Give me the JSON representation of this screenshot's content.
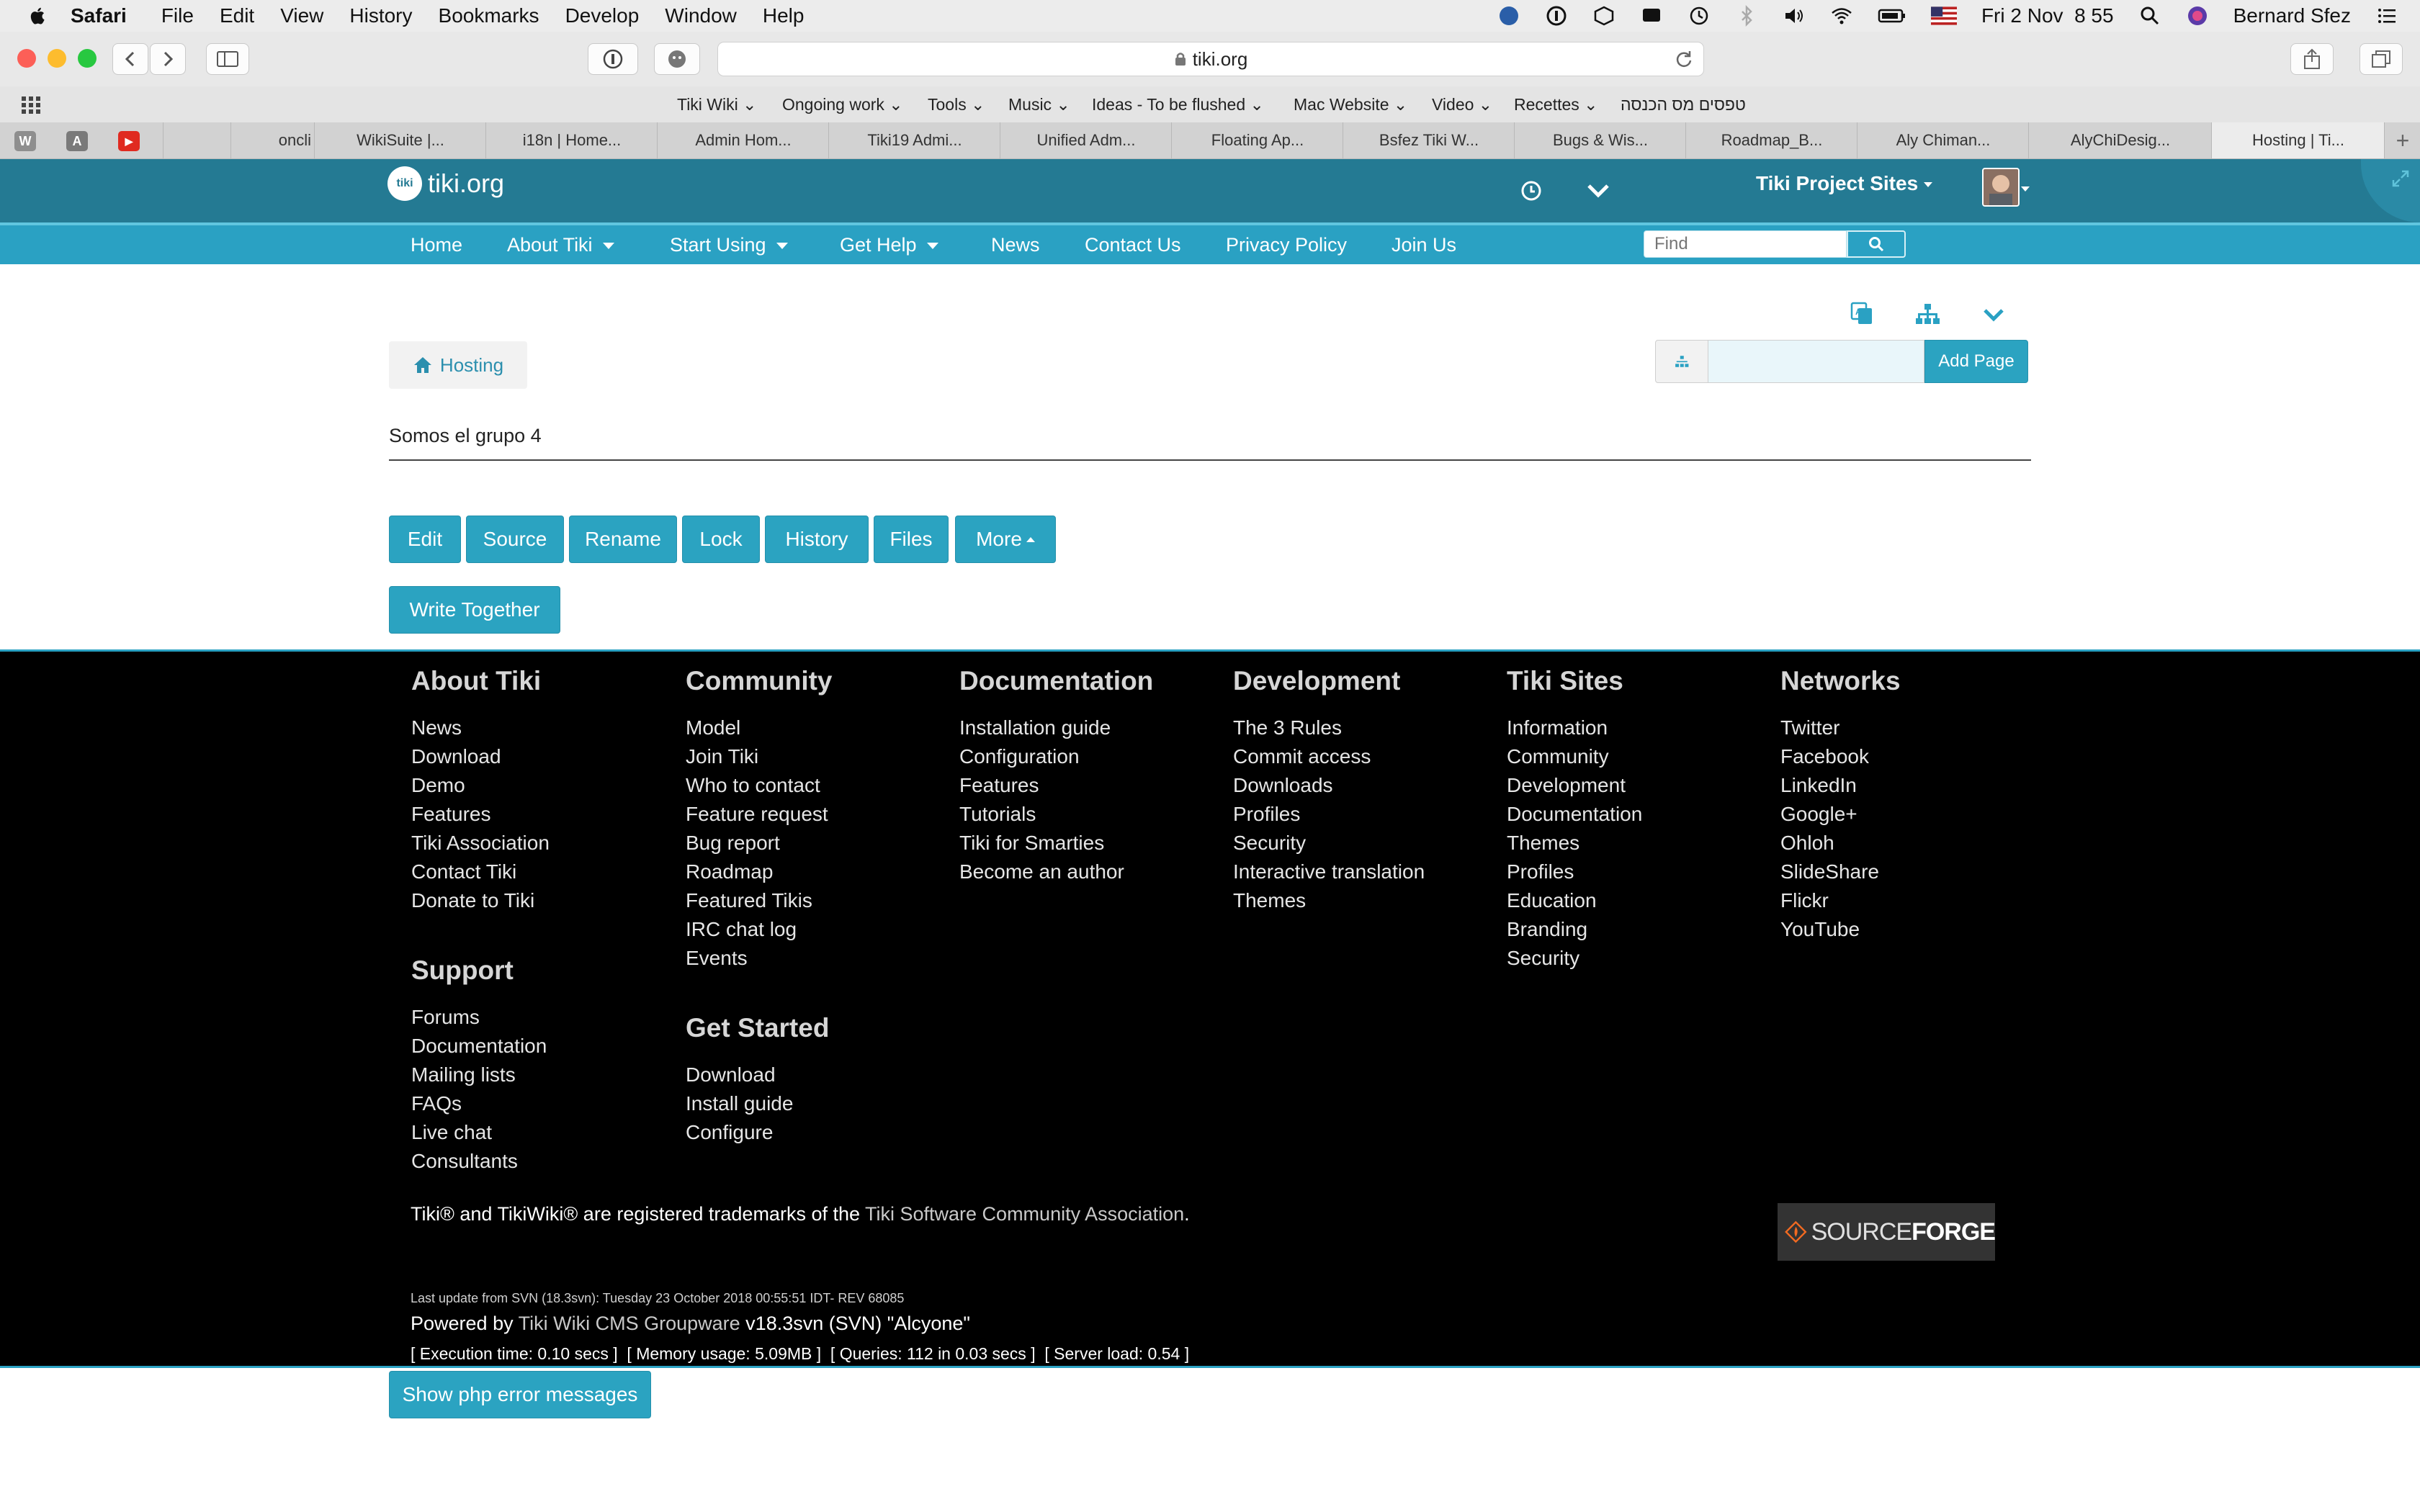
{
  "menubar": {
    "app": "Safari",
    "items": [
      "File",
      "Edit",
      "View",
      "History",
      "Bookmarks",
      "Develop",
      "Window",
      "Help"
    ],
    "datetime": "Fri 2 Nov  8 55",
    "user": "Bernard Sfez"
  },
  "browser": {
    "url": "tiki.org",
    "bookmarks": [
      "Tiki Wiki",
      "Ongoing work",
      "Tools",
      "Music",
      "Ideas - To be flushed",
      "Mac Website",
      "Video",
      "Recettes",
      "טפסים מס הכנסה"
    ],
    "pinned_tabs": [
      "W",
      "A",
      "▶"
    ],
    "tabs": [
      "oncli",
      "WikiSuite |...",
      "i18n | Home...",
      "Admin Hom...",
      "Tiki19 Admi...",
      "Unified Adm...",
      "Floating Ap...",
      "Bsfez Tiki W...",
      "Bugs & Wis...",
      "Roadmap_B...",
      "Aly Chiman...",
      "AlyChiDesig...",
      "Hosting | Ti..."
    ],
    "new_tab": "+"
  },
  "site": {
    "logo_text": "tiki.org",
    "logo_mark": "tiki",
    "project_sites": "Tiki Project Sites",
    "nav": [
      {
        "label": "Home",
        "dropdown": false
      },
      {
        "label": "About Tiki",
        "dropdown": true
      },
      {
        "label": "Start Using",
        "dropdown": true
      },
      {
        "label": "Get Help",
        "dropdown": true
      },
      {
        "label": "News",
        "dropdown": false
      },
      {
        "label": "Contact Us",
        "dropdown": false
      },
      {
        "label": "Privacy Policy",
        "dropdown": false
      },
      {
        "label": "Join Us",
        "dropdown": false
      }
    ],
    "search_placeholder": "Find"
  },
  "page": {
    "breadcrumb": "Hosting",
    "content_text": "Somos el grupo 4",
    "add_page_label": "Add Page",
    "actions": [
      "Edit",
      "Source",
      "Rename",
      "Lock",
      "History",
      "Files",
      "More"
    ],
    "write_together": "Write Together",
    "show_php_errors": "Show php error messages"
  },
  "footer": {
    "columns": [
      {
        "title": "About Tiki",
        "links": [
          "News",
          "Download",
          "Demo",
          "Features",
          "Tiki Association",
          "Contact Tiki",
          "Donate to Tiki"
        ]
      },
      {
        "title": "Community",
        "links": [
          "Model",
          "Join Tiki",
          "Who to contact",
          "Feature request",
          "Bug report",
          "Roadmap",
          "Featured Tikis",
          "IRC chat log",
          "Events"
        ]
      },
      {
        "title": "Documentation",
        "links": [
          "Installation guide",
          "Configuration",
          "Features",
          "Tutorials",
          "Tiki for Smarties",
          "Become an author"
        ]
      },
      {
        "title": "Development",
        "links": [
          "The 3 Rules",
          "Commit access",
          "Downloads",
          "Profiles",
          "Security",
          "Interactive translation",
          "Themes"
        ]
      },
      {
        "title": "Tiki Sites",
        "links": [
          "Information",
          "Community",
          "Development",
          "Documentation",
          "Themes",
          "Profiles",
          "Education",
          "Branding",
          "Security"
        ]
      },
      {
        "title": "Networks",
        "links": [
          "Twitter",
          "Facebook",
          "LinkedIn",
          "Google+",
          "Ohloh",
          "SlideShare",
          "Flickr",
          "YouTube"
        ]
      },
      {
        "title": "Support",
        "links": [
          "Forums",
          "Documentation",
          "Mailing lists",
          "FAQs",
          "Live chat",
          "Consultants"
        ]
      },
      {
        "title": "Get Started",
        "links": [
          "Download",
          "Install guide",
          "Configure"
        ]
      }
    ],
    "trademark_prefix": "Tiki® and TikiWiki® are registered trademarks of the",
    "trademark_link": "Tiki Software Community Association",
    "trademark_suffix": ".",
    "sourceforge": {
      "source": "SOURCE",
      "forge": "FORGE"
    },
    "last_update": "Last update from SVN (18.3svn): Tuesday 23 October 2018 00:55:51 IDT- REV 68085",
    "powered_prefix": "Powered by",
    "powered_link": "Tiki Wiki CMS Groupware",
    "powered_suffix": "v18.3svn (SVN) \"Alcyone\"",
    "stats": "[ Execution time: 0.10 secs ]  [ Memory usage: 5.09MB ]  [ Queries: 112 in 0.03 secs ]  [ Server load: 0.54 ]"
  },
  "colors": {
    "header": "#247a93",
    "nav": "#2aa1c3",
    "button": "#2ba3c1",
    "footer": "#000000"
  }
}
